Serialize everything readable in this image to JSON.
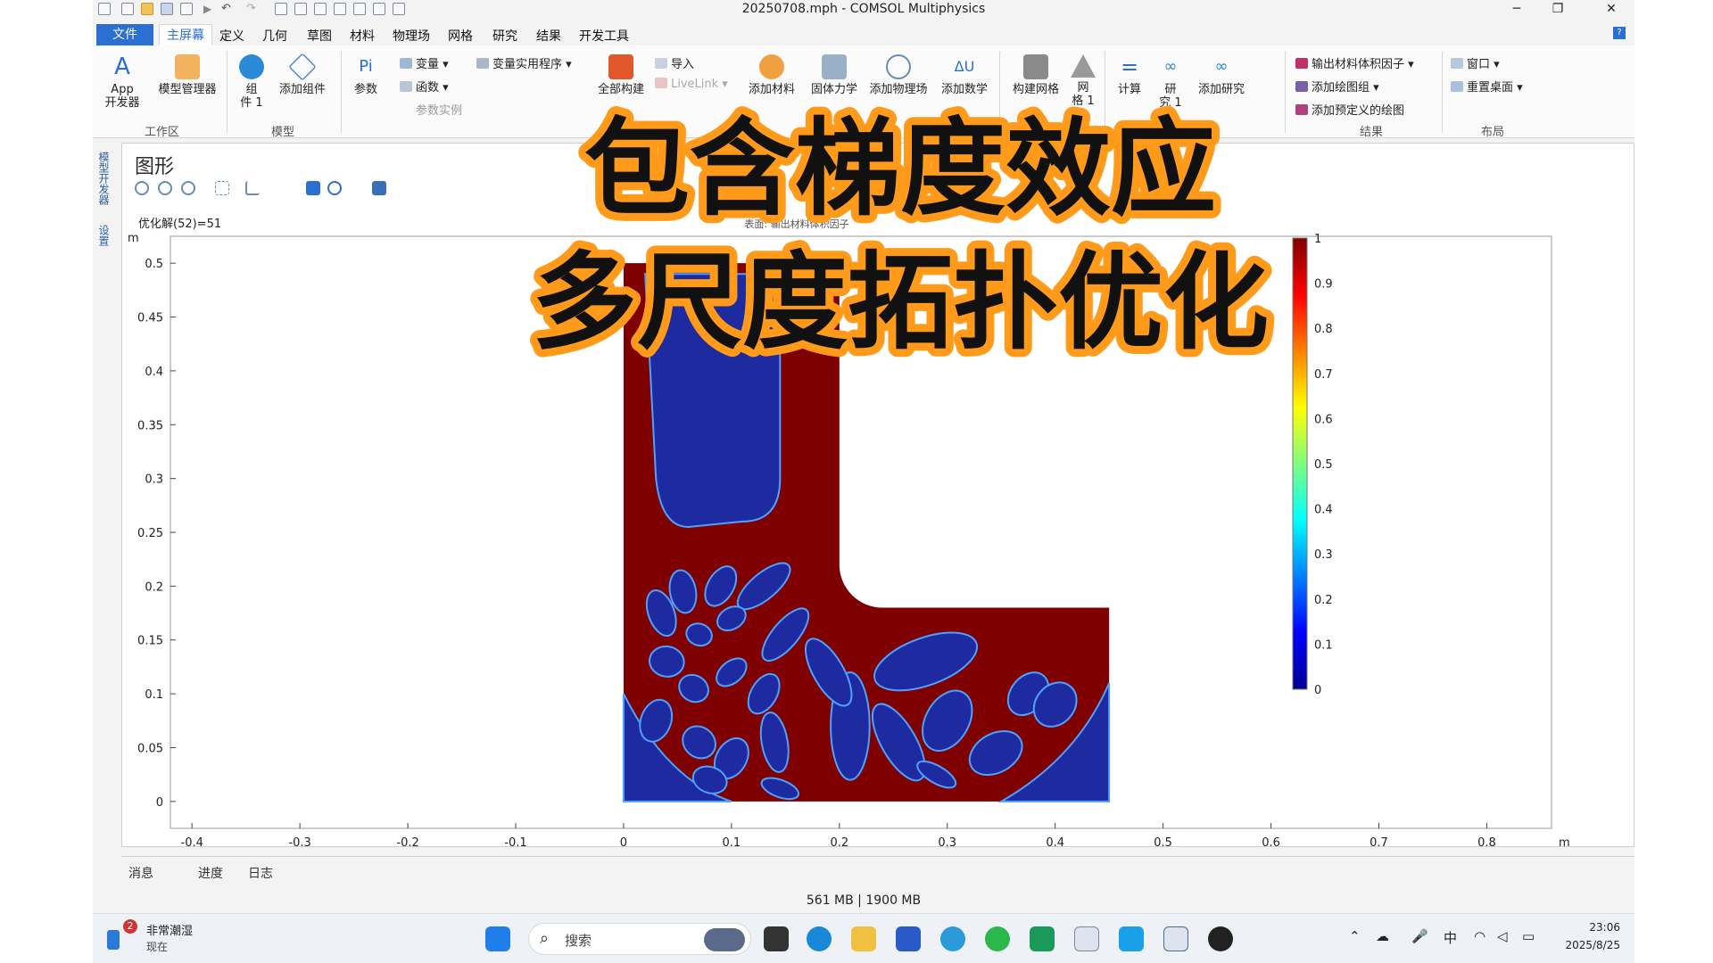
{
  "window": {
    "title": "20250708.mph - COMSOL Multiphysics",
    "minimize_glyph": "─",
    "restore_glyph": "❐",
    "close_glyph": "✕"
  },
  "menu": {
    "file": "文件",
    "home": "主屏幕",
    "items": [
      "定义",
      "几何",
      "草图",
      "材料",
      "物理场",
      "网格",
      "研究",
      "结果",
      "开发工具"
    ]
  },
  "ribbon": {
    "app_dev_top": "App",
    "app_dev_bottom": "开发器",
    "model_manager": "模型管理器",
    "group_workspace": "工作区",
    "component_top": "组",
    "component_bottom": "件 1",
    "add_component": "添加组件",
    "group_model": "模型",
    "parameters_icon": "Pi",
    "parameters": "参数",
    "variables": "变量",
    "functions": "函数",
    "param_instances": "参数实例",
    "variable_utilities": "变量实用程序",
    "build_all": "全部构建",
    "import": "导入",
    "livelink": "LiveLink",
    "add_material": "添加材料",
    "solid_mechanics": "固体力学",
    "add_physics": "添加物理场",
    "add_math": "添加数学",
    "build_mesh": "构建网格",
    "mesh_top": "网",
    "mesh_bottom": "格 1",
    "compute": "计算",
    "study_top": "研",
    "study_bottom": "究 1",
    "add_study": "添加研究",
    "group_study": "研究",
    "export_material_volume": "输出材料体积因子",
    "add_plot_group": "添加绘图组",
    "add_predefined_plot": "添加预定义的绘图",
    "group_results": "结果",
    "windows": "窗口",
    "reset_desktop": "重置桌面",
    "group_layout": "布局"
  },
  "side_strip": {
    "model_builder": "模型开发器",
    "settings": "设置"
  },
  "graphics": {
    "title": "图形",
    "solution_label": "优化解(52)=51",
    "surface_label": "表面: 输出材料体积因子",
    "y_unit": "m",
    "x_unit": "m"
  },
  "chart_data": {
    "type": "heatmap",
    "title": "表面: 输出材料体积因子",
    "xlabel": "m",
    "ylabel": "m",
    "xlim": [
      -0.42,
      0.86
    ],
    "ylim": [
      -0.025,
      0.525
    ],
    "x_ticks": [
      "-0.4",
      "-0.3",
      "-0.2",
      "-0.1",
      "0",
      "0.1",
      "0.2",
      "0.3",
      "0.4",
      "0.5",
      "0.6",
      "0.7",
      "0.8"
    ],
    "y_ticks": [
      "0",
      "0.05",
      "0.1",
      "0.15",
      "0.2",
      "0.25",
      "0.3",
      "0.35",
      "0.4",
      "0.45",
      "0.5"
    ],
    "colorbar": {
      "range": [
        0,
        1
      ],
      "ticks": [
        "0",
        "0.1",
        "0.2",
        "0.3",
        "0.4",
        "0.5",
        "0.6",
        "0.7",
        "0.8",
        "0.9",
        "1"
      ],
      "colormap": "rainbow"
    },
    "domain": {
      "shape": "L-bracket",
      "outer": [
        [
          0,
          0
        ],
        [
          0.45,
          0
        ],
        [
          0.45,
          0.18
        ],
        [
          0.2,
          0.18
        ],
        [
          0.2,
          0.5
        ],
        [
          0,
          0.5
        ]
      ],
      "inner_fillet_radius": 0.04
    },
    "solid_color": "#7f0000",
    "void_color": "#1e2aa0"
  },
  "overlay": {
    "line1": "包含梯度效应",
    "line2": "多尺度拓扑优化",
    "fill_color": "#111111",
    "stroke_color": "#ff9a1a"
  },
  "messages": {
    "tabs": [
      "消息",
      "进度",
      "日志"
    ]
  },
  "status": {
    "memory": "561 MB | 1900 MB"
  },
  "taskbar": {
    "weather_badge": "2",
    "weather_title": "非常潮湿",
    "weather_sub": "现在",
    "search_placeholder": "搜索",
    "ime": "中",
    "time": "23:06",
    "date": "2025/8/25"
  }
}
